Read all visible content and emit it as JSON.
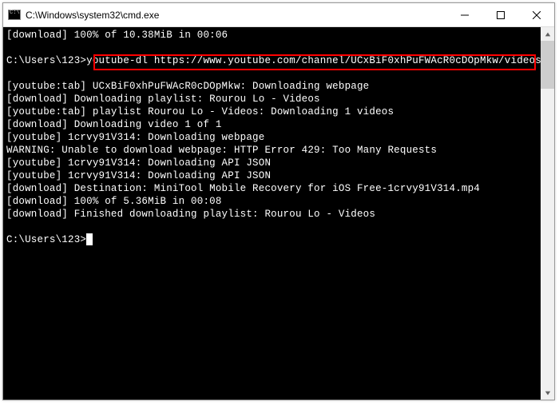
{
  "window": {
    "title": "C:\\Windows\\system32\\cmd.exe"
  },
  "terminal": {
    "lines": [
      "[download] 100% of 10.38MiB in 00:06",
      "",
      "C:\\Users\\123>youtube-dl https://www.youtube.com/channel/UCxBiF0xhPuFWAcR0cDOpMkw/videos",
      "",
      "[youtube:tab] UCxBiF0xhPuFWAcR0cDOpMkw: Downloading webpage",
      "[download] Downloading playlist: Rourou Lo - Videos",
      "[youtube:tab] playlist Rourou Lo - Videos: Downloading 1 videos",
      "[download] Downloading video 1 of 1",
      "[youtube] 1crvy91V314: Downloading webpage",
      "WARNING: Unable to download webpage: HTTP Error 429: Too Many Requests",
      "[youtube] 1crvy91V314: Downloading API JSON",
      "[youtube] 1crvy91V314: Downloading API JSON",
      "[download] Destination: MiniTool Mobile Recovery for iOS Free-1crvy91V314.mp4",
      "[download] 100% of 5.36MiB in 00:08",
      "[download] Finished downloading playlist: Rourou Lo - Videos",
      "",
      "C:\\Users\\123>"
    ],
    "prompt_path": "C:\\Users\\123",
    "highlighted_command": "youtube-dl https://www.youtube.com/channel/UCxBiF0xhPuFWAcR0cDOpMkw/videos"
  }
}
